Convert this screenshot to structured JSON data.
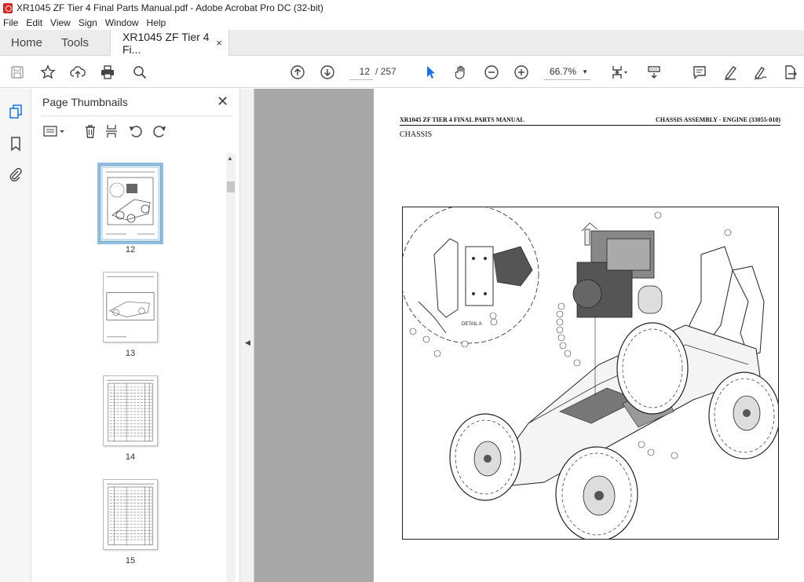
{
  "window": {
    "title": "XR1045 ZF Tier 4 Final Parts Manual.pdf - Adobe Acrobat Pro DC (32-bit)"
  },
  "menu": [
    "File",
    "Edit",
    "View",
    "Sign",
    "Window",
    "Help"
  ],
  "tabs": {
    "home": "Home",
    "tools": "Tools",
    "document": "XR1045 ZF Tier 4 Fi...",
    "close": "×"
  },
  "toolbar": {
    "current_page": "12",
    "total_pages": "/ 257",
    "zoom": "66.7%"
  },
  "panel": {
    "title": "Page Thumbnails",
    "thumbnails": [
      {
        "label": "12",
        "selected": true
      },
      {
        "label": "13",
        "selected": false
      },
      {
        "label": "14",
        "selected": false
      },
      {
        "label": "15",
        "selected": false
      }
    ]
  },
  "document": {
    "header_left": "XR1045 ZF TIER 4 FINAL PARTS MANUAL",
    "header_right": "CHASSIS ASSEMBLY - ENGINE (33055-010)",
    "section": "CHASSIS",
    "detail_label": "DETAIL A"
  },
  "colors": {
    "accent": "#1473e6",
    "panel_bg": "#f6f6f6",
    "doc_bg": "#a8a8a8",
    "acrobat_red": "#d9241c"
  }
}
